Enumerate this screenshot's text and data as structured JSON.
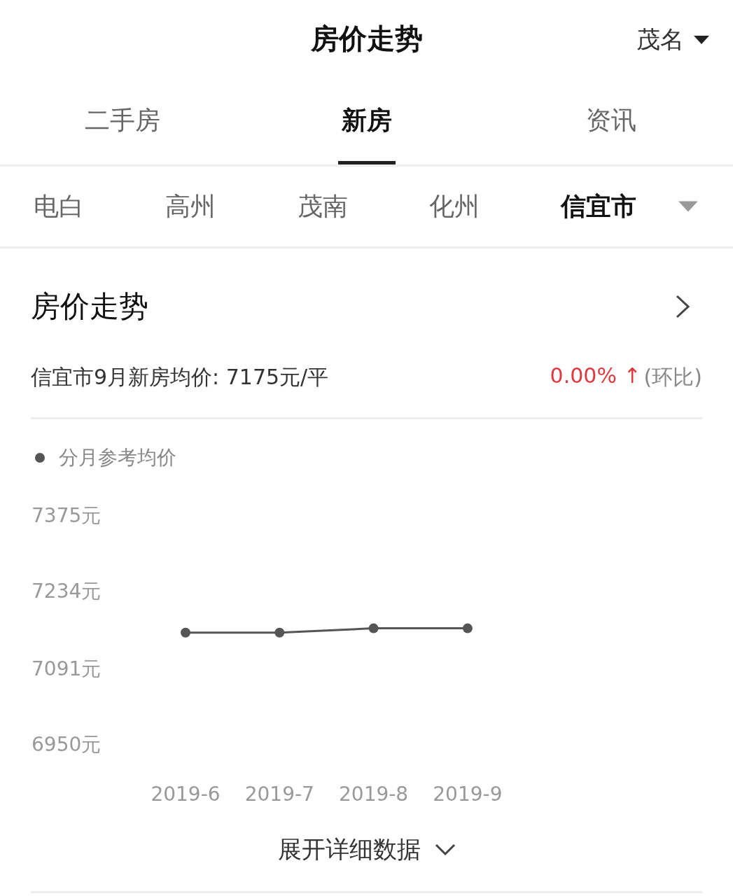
{
  "header": {
    "title": "房价走势",
    "city": "茂名"
  },
  "tabs": [
    {
      "label": "二手房",
      "selected": false
    },
    {
      "label": "新房",
      "selected": true
    },
    {
      "label": "资讯",
      "selected": false
    }
  ],
  "districts": [
    {
      "label": "电白",
      "selected": false
    },
    {
      "label": "高州",
      "selected": false
    },
    {
      "label": "茂南",
      "selected": false
    },
    {
      "label": "化州",
      "selected": false
    },
    {
      "label": "信宜市",
      "selected": true
    }
  ],
  "trend": {
    "title": "房价走势",
    "summary": "信宜市9月新房均价: 7175元/平",
    "change": "0.00% ↑",
    "change_note": "(环比)",
    "chart_data": {
      "type": "line",
      "categories": [
        "2019-6",
        "2019-7",
        "2019-8",
        "2019-9"
      ],
      "series": [
        {
          "name": "分月参考均价",
          "color": "#555555",
          "marker": "circle",
          "values": [
            7157,
            7157,
            7165,
            7165
          ]
        }
      ],
      "ylim": [
        6950,
        7375
      ],
      "yticks": [
        {
          "value": 6950,
          "label": "6950元"
        },
        {
          "value": 7091,
          "label": "7091元"
        },
        {
          "value": 7234,
          "label": "7234元"
        },
        {
          "value": 7375,
          "label": "7375元"
        }
      ]
    },
    "expand": "展开详细数据"
  }
}
